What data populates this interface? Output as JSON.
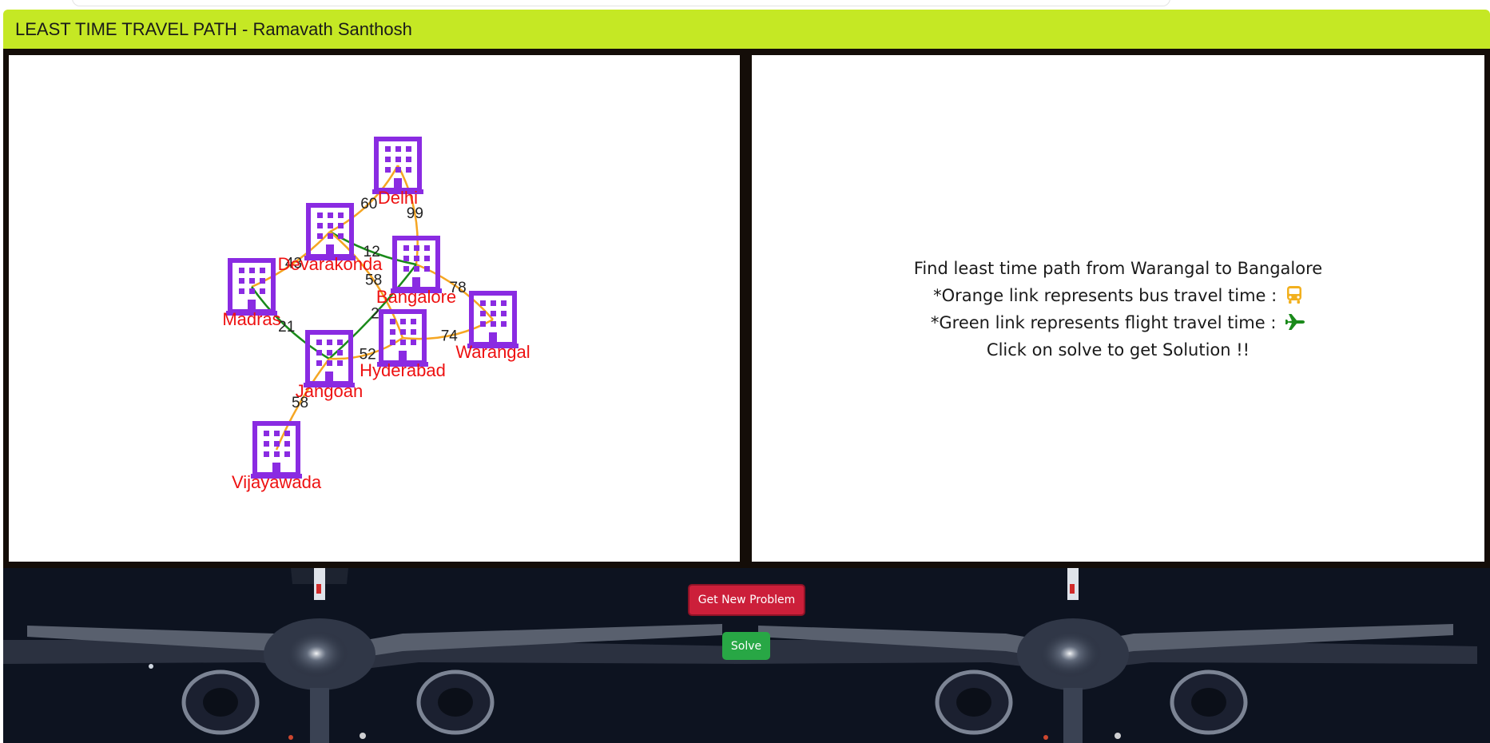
{
  "header": {
    "title": "LEAST TIME TRAVEL PATH - Ramavath Santhosh"
  },
  "graph": {
    "cities": [
      {
        "id": "delhi",
        "label": "Delhi"
      },
      {
        "id": "devarakonda",
        "label": "Devarakonda"
      },
      {
        "id": "bangalore",
        "label": "Bangalore"
      },
      {
        "id": "madras",
        "label": "Madras"
      },
      {
        "id": "hyderabad",
        "label": "Hyderabad"
      },
      {
        "id": "warangal",
        "label": "Warangal"
      },
      {
        "id": "jangoan",
        "label": "Jangoan"
      },
      {
        "id": "vijayawada",
        "label": "Vijayawada"
      }
    ],
    "edges": [
      {
        "from": "devarakonda",
        "to": "delhi",
        "weight": "60",
        "mode": "bus"
      },
      {
        "from": "delhi",
        "to": "bangalore",
        "weight": "99",
        "mode": "bus"
      },
      {
        "from": "madras",
        "to": "devarakonda",
        "weight": "43",
        "mode": "bus"
      },
      {
        "from": "devarakonda",
        "to": "bangalore",
        "weight": "12",
        "mode": "flight"
      },
      {
        "from": "bangalore",
        "to": "warangal",
        "weight": "78",
        "mode": "bus"
      },
      {
        "from": "devarakonda",
        "to": "hyderabad",
        "weight": "58",
        "mode": "bus"
      },
      {
        "from": "jangoan",
        "to": "bangalore",
        "weight": "2",
        "mode": "flight"
      },
      {
        "from": "madras",
        "to": "jangoan",
        "weight": "21",
        "mode": "flight"
      },
      {
        "from": "hyderabad",
        "to": "warangal",
        "weight": "74",
        "mode": "bus"
      },
      {
        "from": "jangoan",
        "to": "hyderabad",
        "weight": "52",
        "mode": "bus"
      },
      {
        "from": "jangoan",
        "to": "vijayawada",
        "weight": "58",
        "mode": "bus"
      }
    ],
    "colors": {
      "bus": "#f5a623",
      "flight": "#1a8a1a",
      "city_icon": "#8a2be2",
      "city_label": "#ee1111"
    }
  },
  "info": {
    "line1": "Find least time path from Warangal to Bangalore",
    "line2": "*Orange link represents bus travel time :",
    "line3": "*Green link represents flight travel time :",
    "line4": "Click on solve to get Solution !!",
    "bus_icon": "bus-icon",
    "plane_icon": "plane-icon"
  },
  "buttons": {
    "new_problem": "Get New Problem",
    "solve": "Solve"
  }
}
